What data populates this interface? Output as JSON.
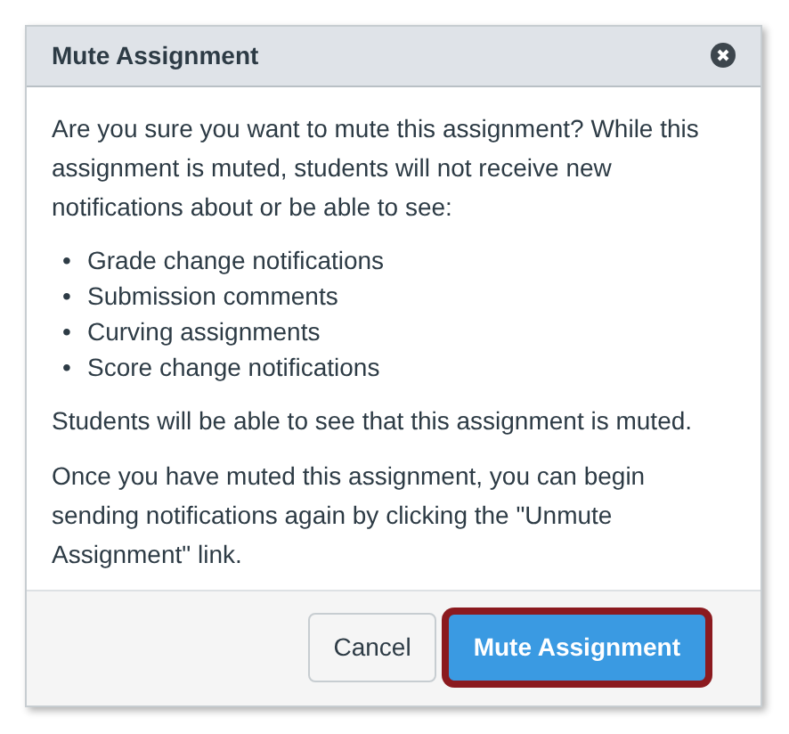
{
  "dialog": {
    "title": "Mute Assignment",
    "paragraphs_before": [
      "Are you sure you want to mute this assignment? While this assignment is muted, students will not receive new notifications about or be able to see:"
    ],
    "list": [
      {
        "marker": "•",
        "text": "Grade change notifications"
      },
      {
        "marker": "•",
        "text": "Submission comments"
      },
      {
        "marker": "•",
        "text": "Curving assignments"
      },
      {
        "marker": "•",
        "text": "Score change notifications"
      }
    ],
    "paragraphs_after": [
      "Students will be able to see that this assignment is muted.",
      "Once you have muted this assignment, you can begin sending notifications again by clicking the \"Unmute Assignment\" link."
    ],
    "buttons": [
      {
        "label": "Cancel",
        "kind": "secondary",
        "highlighted": false
      },
      {
        "label": "Mute Assignment",
        "kind": "primary",
        "highlighted": true
      }
    ]
  }
}
